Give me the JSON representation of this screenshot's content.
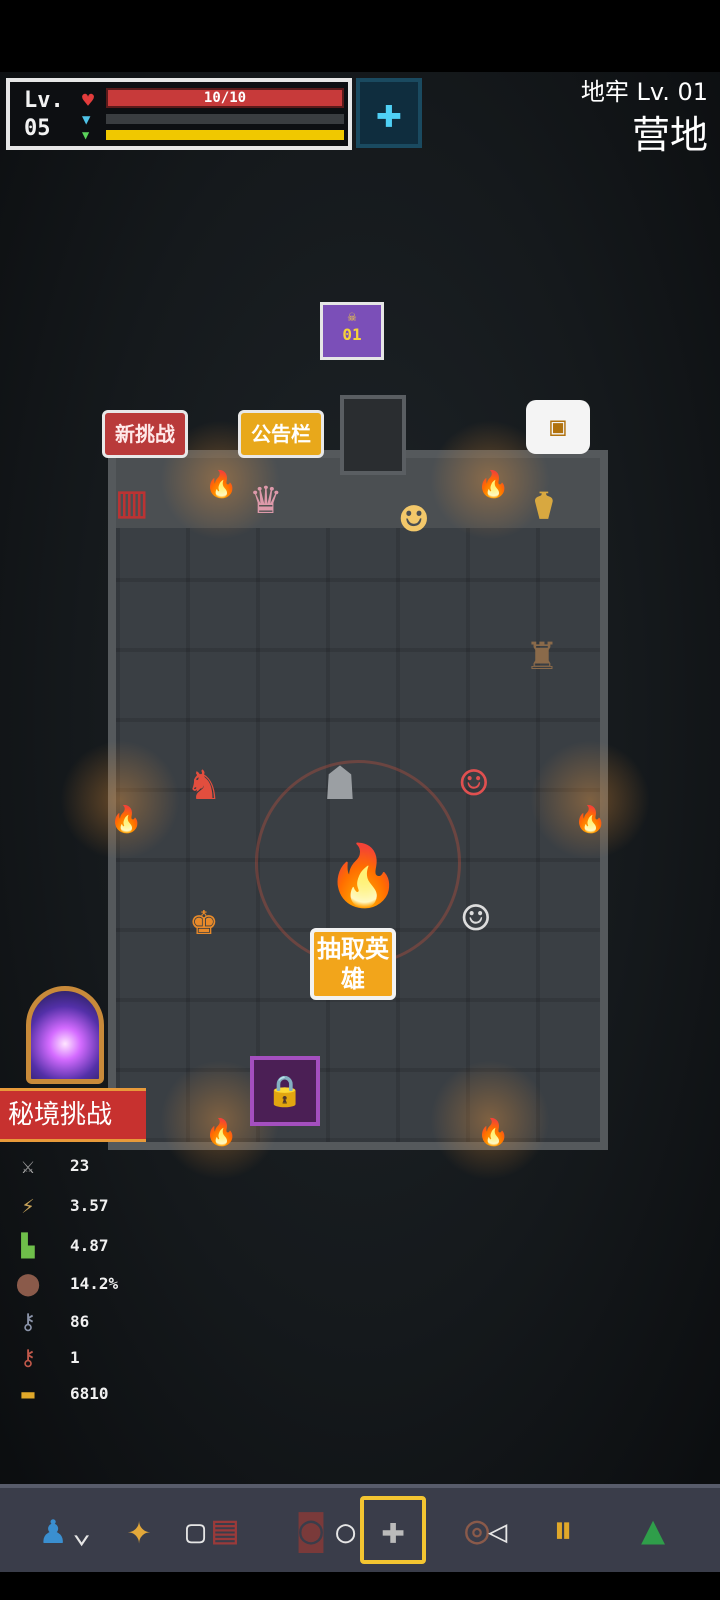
{
  "hud": {
    "level_label": "Lv.",
    "level_value": "05",
    "hp_text": "10/10",
    "hp_fraction": 1.0,
    "mana_fraction": 0.0,
    "xp_fraction": 1.0
  },
  "location": {
    "dungeon_level": "地牢 Lv. 01",
    "area_name": "营地"
  },
  "badge": {
    "number": "01"
  },
  "signs": {
    "new_challenge": "新挑战",
    "bulletin_board": "公告栏",
    "draw_hero": "抽取英雄"
  },
  "portal": {
    "label": "秘境挑战"
  },
  "stats": [
    {
      "icon": "sword-icon",
      "value": "23"
    },
    {
      "icon": "attack-speed-icon",
      "value": "3.57"
    },
    {
      "icon": "boot-icon",
      "value": "4.87"
    },
    {
      "icon": "shield-icon",
      "value": "14.2%"
    },
    {
      "icon": "blue-key-icon",
      "value": "86"
    },
    {
      "icon": "red-key-icon",
      "value": "1"
    },
    {
      "icon": "gold-icon",
      "value": "6810"
    }
  ],
  "colors": {
    "hp": "#c73a3a",
    "xp": "#f0c800",
    "accent_orange": "#f2a51b",
    "portal_red": "#c7312f"
  },
  "bottom_tabs": [
    {
      "icon": "hero-icon",
      "active": false
    },
    {
      "icon": "star-icon",
      "active": false
    },
    {
      "icon": "book-icon",
      "active": false
    },
    {
      "icon": "bag-icon",
      "active": false
    },
    {
      "icon": "camp-icon",
      "active": true
    },
    {
      "icon": "ring-icon",
      "active": false
    },
    {
      "icon": "pause-icon",
      "active": false
    },
    {
      "icon": "up-icon",
      "active": false
    }
  ]
}
